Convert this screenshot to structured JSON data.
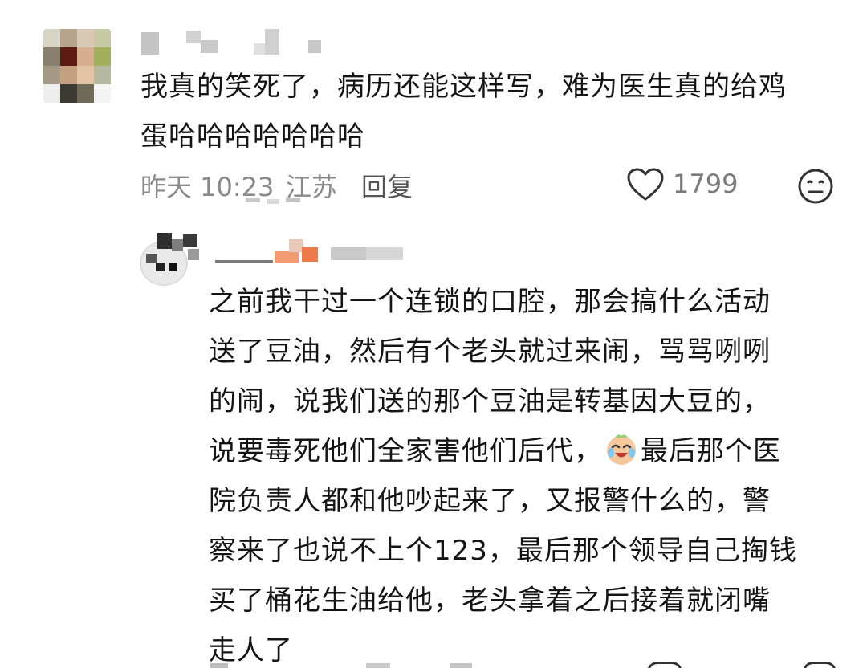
{
  "comment": {
    "text": "我真的笑死了，病历还能这样写，难为医生真的给鸡\n蛋哈哈哈哈哈哈哈",
    "time": "昨天 10:23",
    "location": "江苏",
    "reply_label": "回复",
    "like_count": "1799"
  },
  "reply": {
    "text_before_emoji": "之前我干过一个连锁的口腔，那会搞什么活动\n送了豆油，然后有个老头就过来闹，骂骂咧咧\n的闹，说我们送的那个豆油是转基因大豆的，\n说要毒死他们全家害他们后代，",
    "emoji": "crying-laughing-emoji",
    "text_after_emoji": "最后那个医\n院负责人都和他吵起来了，又报警什么的，警\n察来了也说不上个123，最后那个领导自己掏钱\n买了桶花生油给他，老头拿着之后接着就闭嘴\n走人了"
  },
  "icons": {
    "like": "heart-outline-icon",
    "emoji_react": "neutral-face-icon"
  },
  "colors": {
    "text": "#141414",
    "meta": "#8a8a8a",
    "accent_orange": "#f08a5a"
  }
}
